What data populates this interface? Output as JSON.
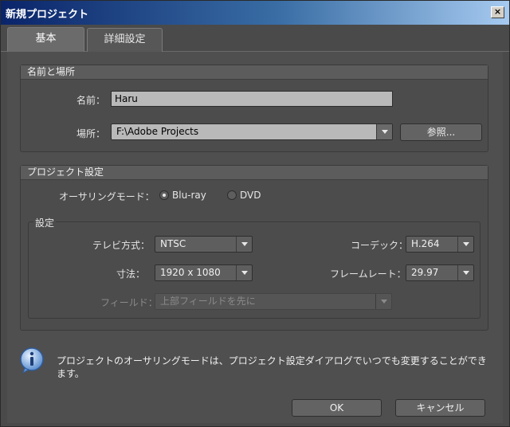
{
  "window": {
    "title": "新規プロジェクト",
    "close_glyph": "×"
  },
  "tabs": [
    {
      "label": "基本",
      "active": true
    },
    {
      "label": "詳細設定",
      "active": false
    }
  ],
  "name_location": {
    "header": "名前と場所",
    "name_label": "名前：",
    "name_value": "Haru",
    "location_label": "場所：",
    "location_value": "F:\\Adobe Projects",
    "browse_label": "参照..."
  },
  "project_settings": {
    "header": "プロジェクト設定",
    "authoring_label": "オーサリングモード：",
    "authoring_options": [
      {
        "label": "Blu-ray",
        "checked": true
      },
      {
        "label": "DVD",
        "checked": false
      }
    ],
    "settings_group_label": "設定",
    "tv_format_label": "テレビ方式：",
    "tv_format_value": "NTSC",
    "codec_label": "コーデック：",
    "codec_value": "H.264",
    "dimensions_label": "寸法：",
    "dimensions_value": "1920 x 1080",
    "frame_rate_label": "フレームレート：",
    "frame_rate_value": "29.97",
    "field_label": "フィールド：",
    "field_value": "上部フィールドを先に"
  },
  "info": {
    "icon": "info-icon",
    "text": "プロジェクトのオーサリングモードは、プロジェクト設定ダイアログでいつでも変更することができます。"
  },
  "buttons": {
    "ok": "OK",
    "cancel": "キャンセル"
  }
}
